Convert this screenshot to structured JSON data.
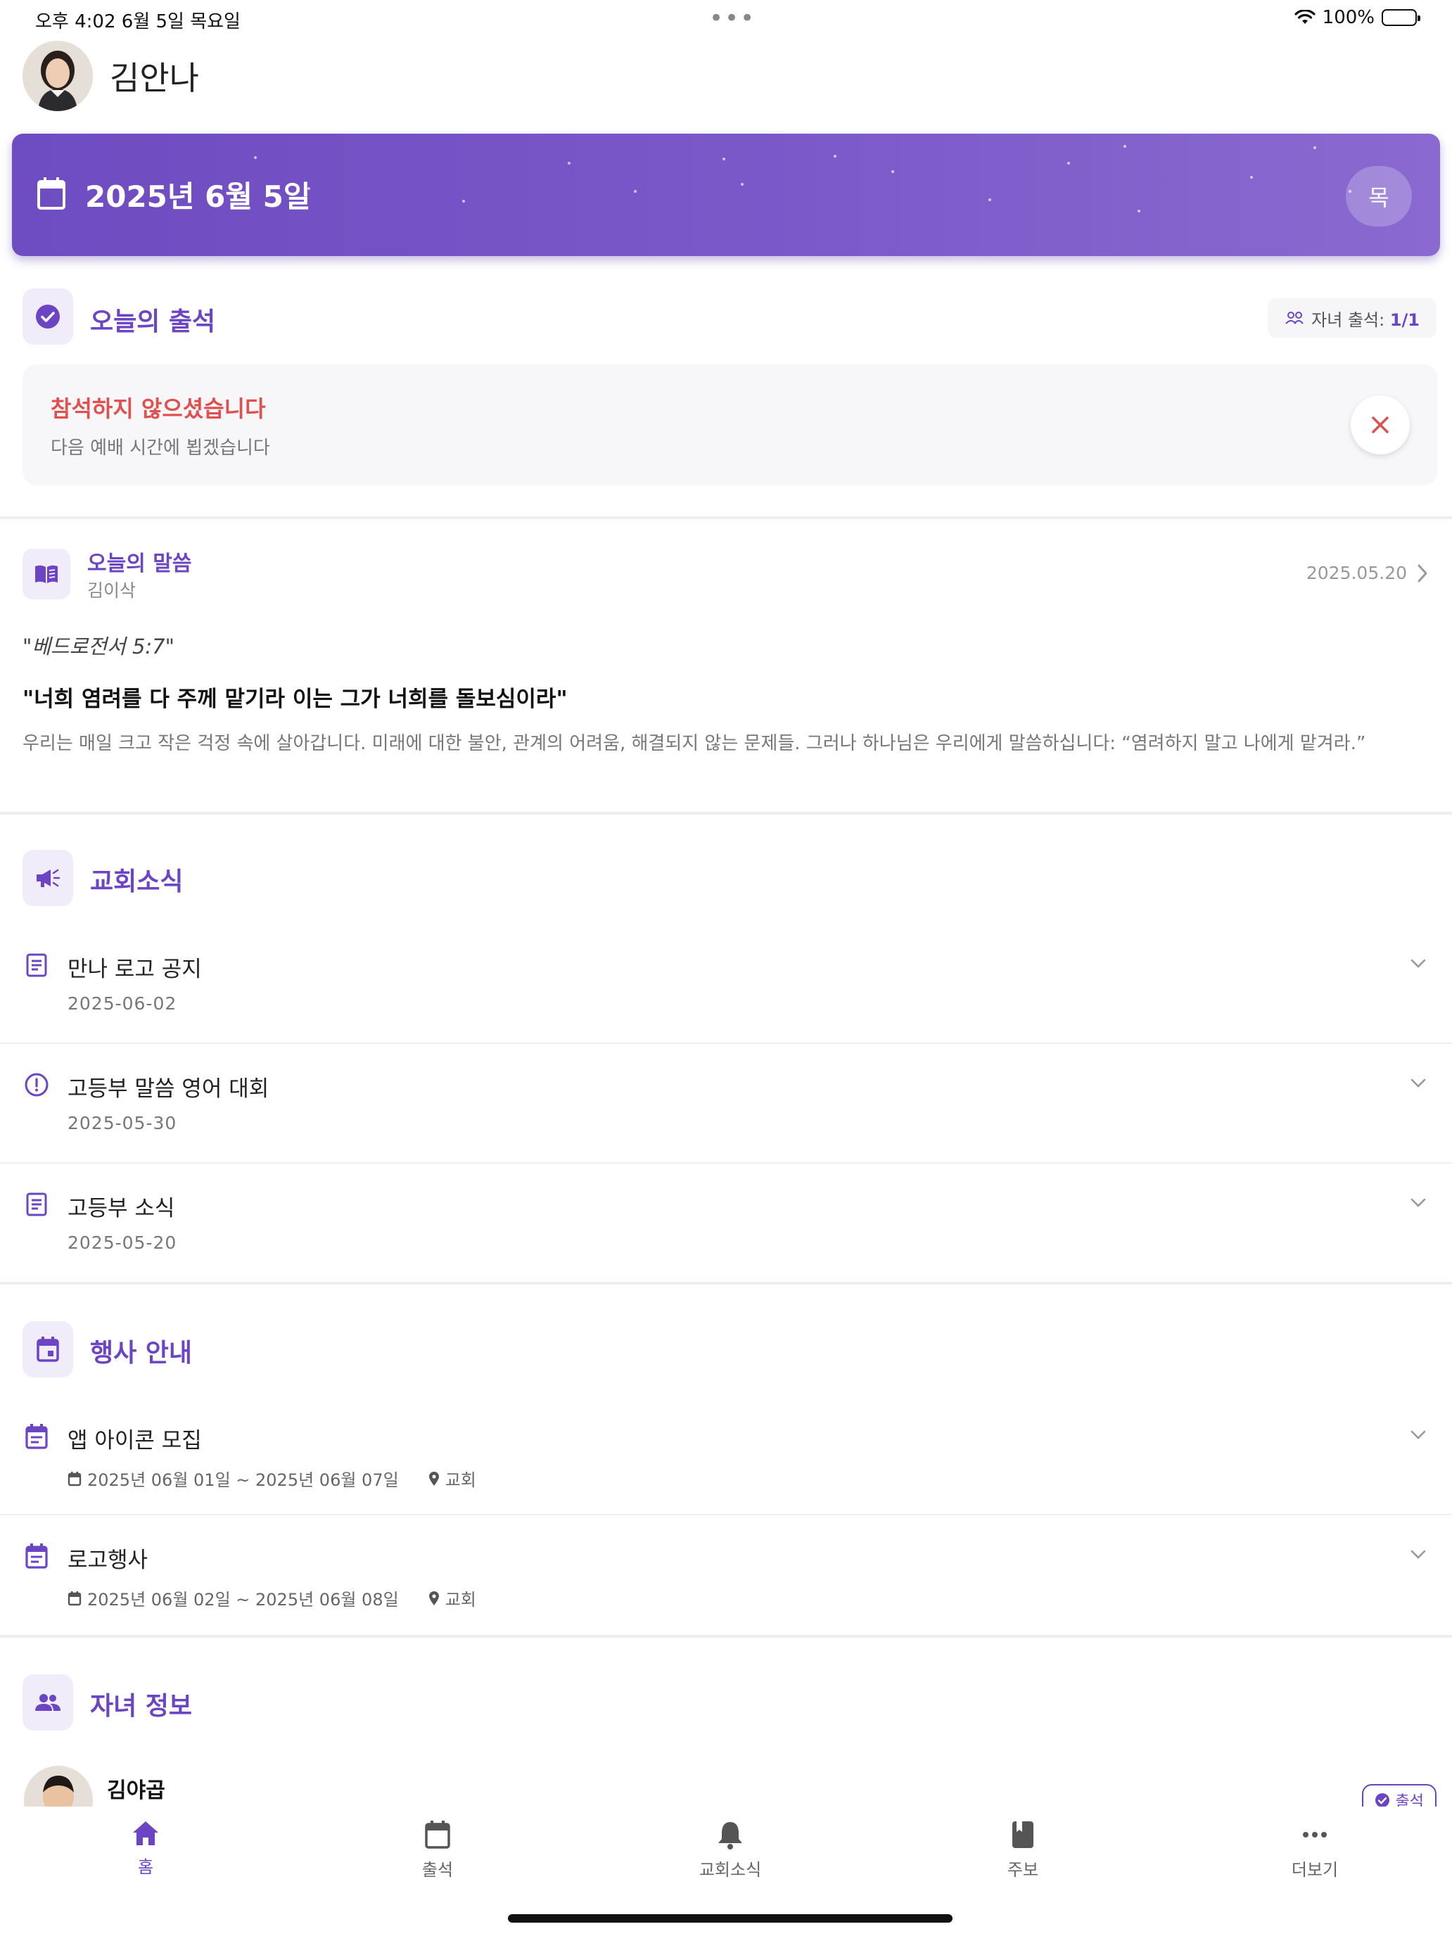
{
  "status_bar": {
    "time_date": "오후 4:02   6월 5일 목요일",
    "dots": "•••",
    "battery": "100%"
  },
  "profile": {
    "name": "김안나"
  },
  "banner": {
    "date": "2025년 6월 5일",
    "weekday": "목"
  },
  "attendance": {
    "title": "오늘의 출석",
    "child_label": "자녀 출석: ",
    "child_count": "1/1",
    "status_title": "참석하지 않으셨습니다",
    "status_sub": "다음 예배 시간에 뵙겠습니다"
  },
  "word": {
    "title": "오늘의 말씀",
    "author": "김이삭",
    "date": "2025.05.20",
    "reference": "\"베드로전서 5:7\"",
    "verse": "\"너희 염려를 다 주께 맡기라 이는 그가 너희를 돌보심이라\"",
    "body": "우리는 매일 크고 작은 걱정 속에 살아갑니다. 미래에 대한 불안, 관계의 어려움, 해결되지 않는 문제들. 그러나 하나님은 우리에게 말씀하십니다: “염려하지 말고 나에게 맡겨라.”"
  },
  "news": {
    "title": "교회소식",
    "items": [
      {
        "icon": "document-icon",
        "title": "만나 로고 공지",
        "date": "2025-06-02"
      },
      {
        "icon": "alert-circle-icon",
        "title": "고등부 말씀 영어 대회",
        "date": "2025-05-30"
      },
      {
        "icon": "document-icon",
        "title": "고등부 소식",
        "date": "2025-05-20"
      }
    ]
  },
  "events": {
    "title": "행사 안내",
    "items": [
      {
        "title": "앱 아이콘 모집",
        "period": "2025년 06월 01일 ~ 2025년 06월 07일",
        "place": "교회"
      },
      {
        "title": "로고행사",
        "period": "2025년 06월 02일 ~ 2025년 06월 08일",
        "place": "교회"
      }
    ]
  },
  "children": {
    "title": "자녀 정보",
    "items": [
      {
        "name": "김야곱",
        "badge": "출석"
      }
    ]
  },
  "tabs": [
    {
      "label": "홈",
      "icon": "home-icon",
      "active": true
    },
    {
      "label": "출석",
      "icon": "calendar-icon",
      "active": false
    },
    {
      "label": "교회소식",
      "icon": "bell-icon",
      "active": false
    },
    {
      "label": "주보",
      "icon": "book-icon",
      "active": false
    },
    {
      "label": "더보기",
      "icon": "more-icon",
      "active": false
    }
  ],
  "colors": {
    "accent": "#6b45c4",
    "danger": "#e0504f",
    "banner_start": "#6e4cc1",
    "banner_end": "#8a6ad0"
  }
}
